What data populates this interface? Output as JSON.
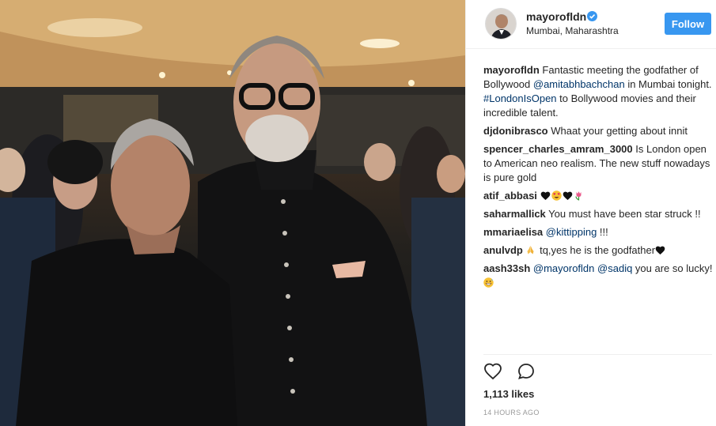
{
  "post": {
    "photo_icon": "photo-of-two-men-at-event",
    "header": {
      "username": "mayorofldn",
      "verified_icon": "verified-badge-icon",
      "location": "Mumbai, Maharashtra",
      "follow_label": "Follow"
    },
    "comments": [
      {
        "user": "mayorofldn",
        "parts": [
          {
            "t": "text",
            "v": "Fantastic meeting the godfather of Bollywood "
          },
          {
            "t": "link",
            "v": "@amitabhbachchan"
          },
          {
            "t": "text",
            "v": " in Mumbai tonight. "
          },
          {
            "t": "link",
            "v": "#LondonIsOpen"
          },
          {
            "t": "text",
            "v": " to Bollywood movies and their incredible talent."
          }
        ]
      },
      {
        "user": "djdonibrasco",
        "parts": [
          {
            "t": "text",
            "v": "Whaat your getting about innit"
          }
        ]
      },
      {
        "user": "spencer_charles_amram_3000",
        "parts": [
          {
            "t": "text",
            "v": "Is London open to American neo realism. The new stuff nowadays is pure gold"
          }
        ]
      },
      {
        "user": "atif_abbasi",
        "parts": [
          {
            "t": "emoji",
            "v": "black-heart-emoji"
          },
          {
            "t": "emoji",
            "v": "heart-eyes-emoji"
          },
          {
            "t": "emoji",
            "v": "black-heart-emoji"
          },
          {
            "t": "emoji",
            "v": "tulip-emoji"
          }
        ]
      },
      {
        "user": "saharmallick",
        "parts": [
          {
            "t": "text",
            "v": "You must have been star struck !!"
          }
        ]
      },
      {
        "user": "mmariaelisa",
        "parts": [
          {
            "t": "link",
            "v": "@kittipping"
          },
          {
            "t": "text",
            "v": " !!!"
          }
        ]
      },
      {
        "user": "anulvdp",
        "parts": [
          {
            "t": "emoji",
            "v": "folded-hands-emoji"
          },
          {
            "t": "text",
            "v": " tq,yes he is the godfather"
          },
          {
            "t": "emoji",
            "v": "black-heart-emoji"
          }
        ]
      },
      {
        "user": "aash33sh",
        "parts": [
          {
            "t": "link",
            "v": "@mayorofldn"
          },
          {
            "t": "text",
            "v": " "
          },
          {
            "t": "link",
            "v": "@sadiq"
          },
          {
            "t": "text",
            "v": " you are so lucky! "
          },
          {
            "t": "emoji",
            "v": "grinning-sweat-emoji"
          }
        ]
      }
    ],
    "actions": {
      "like_icon": "heart-outline-icon",
      "comment_icon": "comment-bubble-icon"
    },
    "likes": "1,113 likes",
    "timestamp": "14 HOURS AGO"
  },
  "colors": {
    "accent": "#3897f0",
    "link": "#003569",
    "muted": "#999999"
  }
}
